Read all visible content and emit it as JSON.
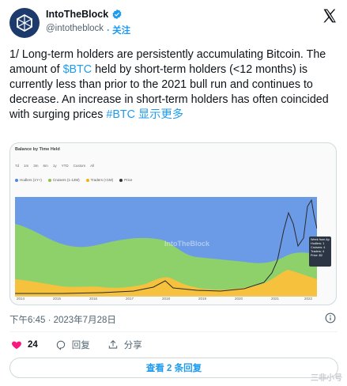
{
  "author": {
    "display_name": "IntoTheBlock",
    "handle": "@intotheblock",
    "follow_label": "· 关注",
    "avatar_icon": "intotheblock-logo"
  },
  "tweet": {
    "segments": [
      "1/ Long-term holders are persistently accumulating Bitcoin. The amount of ",
      "$BTC",
      " held by short-term holders (<12 months) is currently less than prior to the 2021 bull run and continues to decrease. An increase in short-term holders has often coincided with surging prices ",
      "#BTC",
      " 显示更多"
    ],
    "timestamp": "下午6:45 · 2023年7月28日"
  },
  "media": {
    "title": "Balance by Time Held",
    "ranges": [
      "7d",
      "1m",
      "3m",
      "6m",
      "1y",
      "YTD",
      "Custom",
      "All"
    ],
    "legend": [
      {
        "label": "Hodlers (1Y+)",
        "color": "#4a86e8"
      },
      {
        "label": "Cruisers (1-12M)",
        "color": "#8bc34a"
      },
      {
        "label": "Traders (<1M)",
        "color": "#f4b400"
      },
      {
        "label": "Price",
        "color": "#333333"
      }
    ],
    "watermark": "IntoTheBlock",
    "x_ticks": [
      "2014",
      "2015",
      "2016",
      "2017",
      "2018",
      "2019",
      "2020",
      "2021",
      "2022"
    ],
    "tooltip": [
      "Week from Ap",
      "Hodlers: 1",
      "Cruisers: 4",
      "Traders: 4",
      "Price: $2"
    ]
  },
  "actions": {
    "likes": "24",
    "reply_label": "回复",
    "share_label": "分享"
  },
  "replies_button": "查看 2 条回复",
  "corner_mark": "三非小号"
}
